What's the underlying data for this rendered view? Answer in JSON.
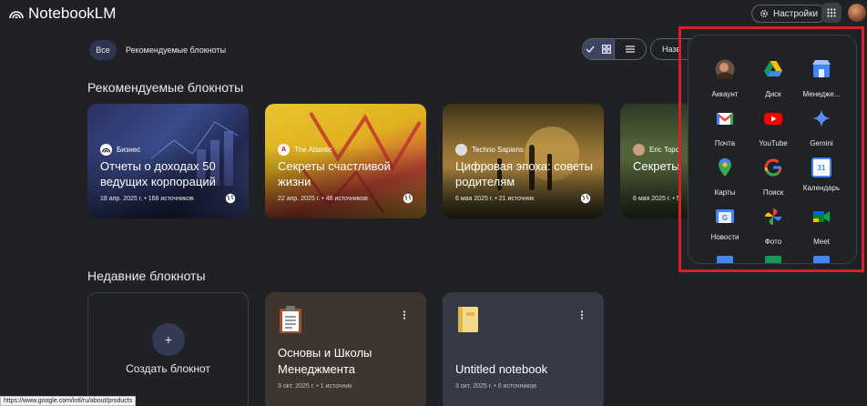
{
  "app": {
    "title": "NotebookLM"
  },
  "topbar": {
    "settings_label": "Настройки"
  },
  "filters": {
    "all": "Все",
    "recommended": "Рекомендуемые блокноты"
  },
  "sort": {
    "label": "Назв"
  },
  "sections": {
    "recommended": "Рекомендуемые блокноты",
    "recent": "Недавние блокноты"
  },
  "featured": [
    {
      "source": "Бизнес",
      "title": "Отчеты о доходах 50 ведущих корпораций",
      "meta": "18 апр. 2025 г. • 168 источников"
    },
    {
      "source": "The Atlantic",
      "title": "Секреты счастливой жизни",
      "meta": "22 апр. 2025 г. • 46 источников"
    },
    {
      "source": "Techno Sapiens",
      "title": "Цифровая эпоха: советы родителям",
      "meta": "6 мая 2025 г. • 21 источник"
    },
    {
      "source": "Eric Topol",
      "title": "Секреты",
      "meta": "6 мая 2025 г. • 5"
    }
  ],
  "recent": {
    "create_label": "Создать блокнот",
    "notebooks": [
      {
        "title": "Основы и Школы Менеджмента",
        "meta": "3 окт. 2025 г. • 1 источник",
        "emoji": "clipboard-icon"
      },
      {
        "title": "Untitled notebook",
        "meta": "3 окт. 2025 г. • 0 источников",
        "emoji": "notebook-icon"
      }
    ]
  },
  "apps_panel": {
    "apps": [
      {
        "label": "Аккаунт",
        "icon": "account-avatar-icon"
      },
      {
        "label": "Диск",
        "icon": "drive-icon"
      },
      {
        "label": "Менедже...",
        "icon": "business-profile-icon"
      },
      {
        "label": "Почта",
        "icon": "gmail-icon"
      },
      {
        "label": "YouTube",
        "icon": "youtube-icon"
      },
      {
        "label": "Gemini",
        "icon": "gemini-icon"
      },
      {
        "label": "Карты",
        "icon": "maps-icon"
      },
      {
        "label": "Поиск",
        "icon": "google-search-icon"
      },
      {
        "label": "Календарь",
        "icon": "calendar-icon"
      },
      {
        "label": "Новости",
        "icon": "news-icon"
      },
      {
        "label": "Фото",
        "icon": "photos-icon"
      },
      {
        "label": "Meet",
        "icon": "meet-icon"
      }
    ],
    "calendar_day": "31",
    "news_glyph": "G"
  },
  "status_bar": {
    "url": "https://www.google.com/intl/ru/about/products"
  },
  "colors": {
    "background": "#1f2124",
    "highlight": "#d8202a",
    "accent": "#3c4566"
  }
}
